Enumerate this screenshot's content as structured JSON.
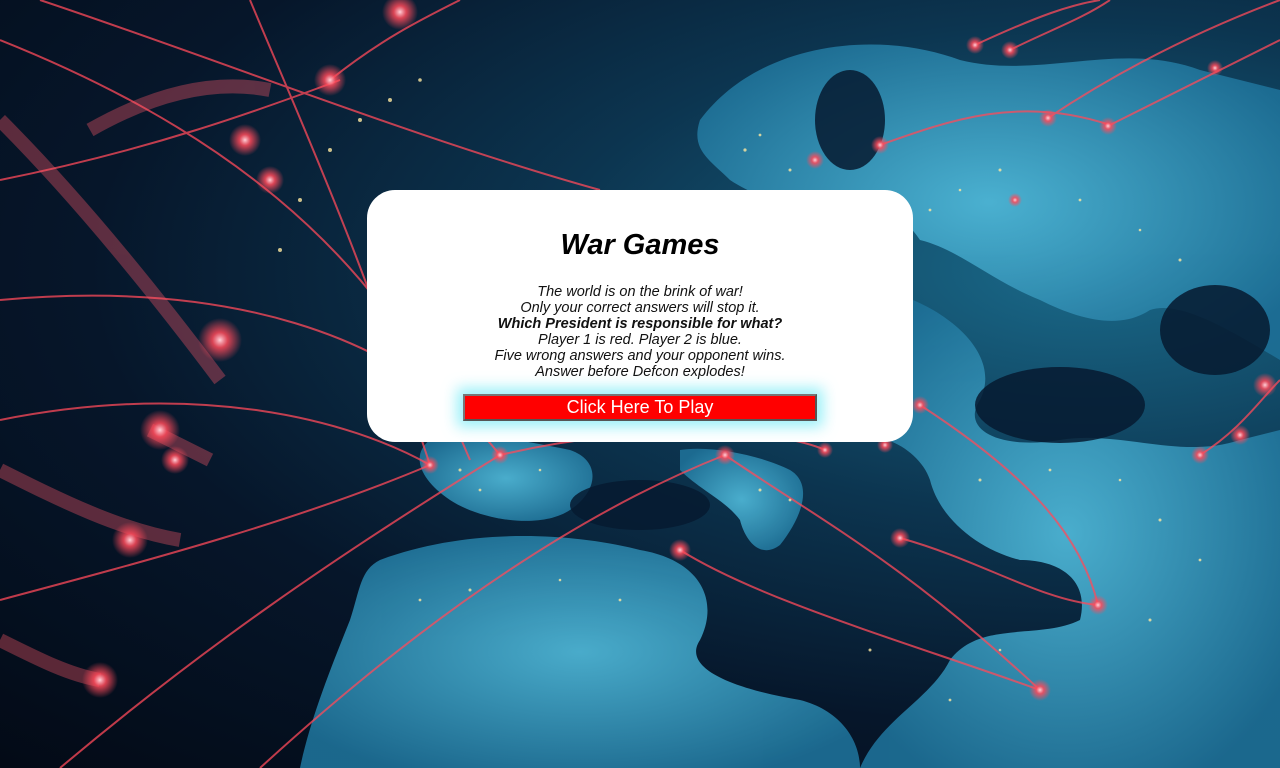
{
  "title": "War Games",
  "intro_lines": [
    "The world is on the brink of war!",
    "Only your correct answers will stop it.",
    "Which President is responsible for what?",
    "Player 1 is red. Player 2 is blue.",
    "Five wrong answers and your opponent wins.",
    "Answer before Defcon explodes!"
  ],
  "play_button_label": "Click Here To Play",
  "colors": {
    "button_background": "#ff0000",
    "button_text": "#ffffff",
    "button_glow": "#78ebf5",
    "modal_background": "#ffffff",
    "background_accent": "#ff4a5a"
  }
}
